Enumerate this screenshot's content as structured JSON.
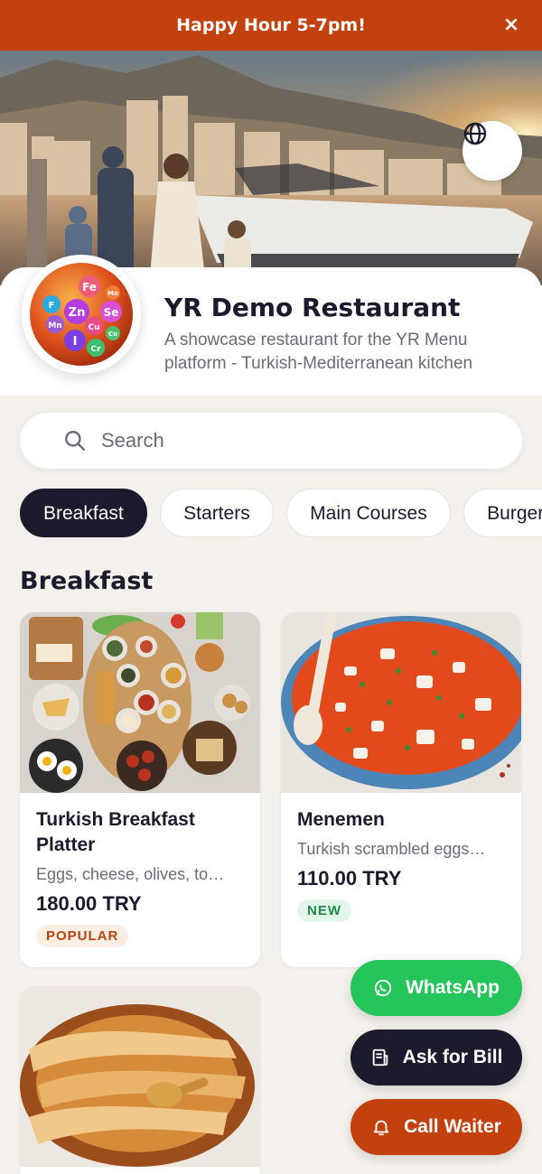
{
  "banner": {
    "text": "Happy Hour 5-7pm!",
    "close_label": "×",
    "color": "#c2410c"
  },
  "hero": {
    "language_icon": "globe-icon"
  },
  "restaurant": {
    "name": "YR Demo Restaurant",
    "description": "A showcase restaurant for the YR Menu platform - Turkish-Mediterranean kitchen",
    "logo_elements": [
      "Fe",
      "Zn",
      "Se",
      "Mn",
      "I",
      "Cu",
      "Cr",
      "F",
      "Mo",
      "Co"
    ]
  },
  "search": {
    "placeholder": "Search",
    "value": "",
    "icon": "search-icon"
  },
  "categories": [
    {
      "label": "Breakfast",
      "active": true
    },
    {
      "label": "Starters",
      "active": false
    },
    {
      "label": "Main Courses",
      "active": false
    },
    {
      "label": "Burgers",
      "active": false
    }
  ],
  "section": {
    "title": "Breakfast"
  },
  "items": [
    {
      "name": "Turkish Breakfast Platter",
      "description": "Eggs, cheese, olives, tomatoes",
      "price": "180.00 TRY",
      "badge": "POPULAR"
    },
    {
      "name": "Menemen",
      "description": "Turkish scrambled eggs with tomatoes",
      "price": "110.00 TRY",
      "badge": "NEW"
    },
    {
      "name": "",
      "description": "",
      "price": "",
      "badge": ""
    }
  ],
  "actions": {
    "whatsapp": "WhatsApp",
    "bill": "Ask for Bill",
    "waiter": "Call Waiter"
  },
  "colors": {
    "accent": "#c2410c",
    "dark": "#1c1b2e",
    "whatsapp": "#25c55c",
    "background": "#f4f1ec"
  }
}
